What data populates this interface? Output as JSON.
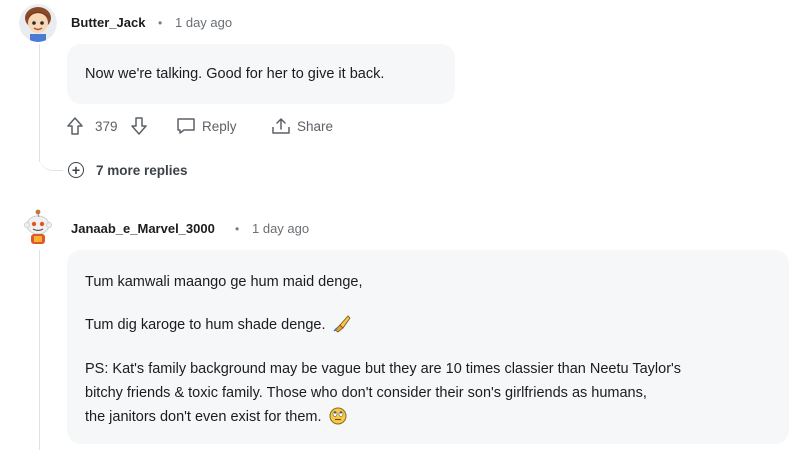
{
  "comment1": {
    "username": "Butter_Jack",
    "separator": "•",
    "time": "1 day ago",
    "body": "Now we're talking. Good for her to give it back.",
    "upvotes": "379",
    "reply_label": "Reply",
    "share_label": "Share"
  },
  "more_replies": {
    "label": "7 more replies"
  },
  "comment2": {
    "username": "Janaab_e_Marvel_3000",
    "separator": "•",
    "time": "1 day ago",
    "line1": "Tum kamwali maango ge hum maid denge,",
    "line2": "Tum dig karoge to hum shade denge.",
    "line3a": "PS: Kat's family background may be vague but they are 10 times classier than Neetu Taylor's",
    "line3b": "bitchy friends & toxic family. Those who don't consider their son's girlfriends as humans,",
    "line3c": "the janitors don't even exist for them."
  },
  "icons": {
    "upvote": "arrow-up-icon",
    "downvote": "arrow-down-icon",
    "reply": "speech-bubble-icon",
    "share": "share-icon",
    "expand": "plus-circle-icon",
    "emoji_brush": "paintbrush-emoji",
    "emoji_face": "rolling-eyes-emoji"
  }
}
